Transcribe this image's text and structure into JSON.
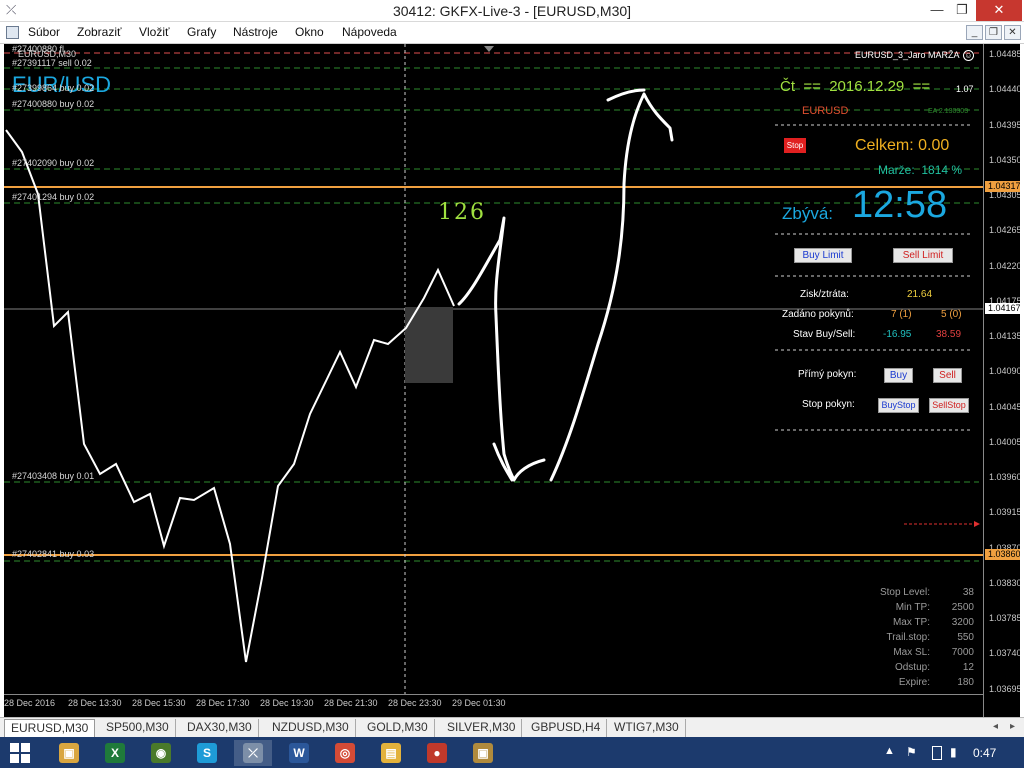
{
  "window": {
    "title": "30412: GKFX-Live-3 - [EURUSD,M30]",
    "minimize": "—",
    "maximize": "❐",
    "close": "✕"
  },
  "menu": [
    "Súbor",
    "Zobraziť",
    "Vložiť",
    "Grafy",
    "Nástroje",
    "Okno",
    "Nápoveda"
  ],
  "chart": {
    "symbol_tiny": "EURUSD,M30",
    "symbol_big": "EUR/USD",
    "annotation": "126",
    "price_ticks": [
      "1.04485",
      "1.04440",
      "1.04395",
      "1.04350",
      "1.04305",
      "1.04265",
      "1.04220",
      "1.04175",
      "1.04135",
      "1.04090",
      "1.04045",
      "1.04005",
      "1.03960",
      "1.03915",
      "1.03870",
      "1.03830",
      "1.03785",
      "1.03740",
      "1.03695"
    ],
    "price_marker_1": "1.04317",
    "price_marker_2": "1.04167",
    "price_marker_3": "1.03860",
    "time_ticks": [
      "28 Dec 2016",
      "28 Dec 13:30",
      "28 Dec 15:30",
      "28 Dec 17:30",
      "28 Dec 19:30",
      "28 Dec 21:30",
      "28 Dec 23:30",
      "29 Dec 01:30"
    ],
    "orders": {
      "o1": "#27400880 fl",
      "o2": "#27391117 sell 0.02",
      "o3": "#27399864 buy 0.02",
      "o4": "#27400880 buy 0.02",
      "o5": "#27402090 buy 0.02",
      "o6": "#27401294 buy 0.02",
      "o7": "#27403408 buy 0.01",
      "o8": "#27402841 buy 0.03"
    }
  },
  "panel": {
    "ea_name": "EURUSD_3_Jaro MARŽA",
    "leverage": "1.07",
    "date_line": "Čt  ==  2016.12.29  ==",
    "symbol": "EURUSD",
    "ea_version": "EA 2.130303",
    "stop_label": "Stop",
    "celkem": "Celkem: 0.00",
    "marze": "Marže:  1814 %",
    "zbyva_label": "Zbývá:",
    "zbyva_time": "12:58",
    "buy_limit": "Buy Limit",
    "sell_limit": "Sell Limit",
    "zisk_label": "Zisk/ztráta:",
    "zisk_value": "21.64",
    "zadano_label": "Zadáno pokynů:",
    "zadano_buy": "7 (1)",
    "zadano_sell": "5 (0)",
    "stav_label": "Stav Buy/Sell:",
    "stav_buy": "-16.95",
    "stav_sell": "38.59",
    "primy_label": "Přímý pokyn:",
    "buy_btn": "Buy",
    "sell_btn": "Sell",
    "stop_pokyn_label": "Stop pokyn:",
    "buystop_btn": "BuyStop",
    "sellstop_btn": "SellStop",
    "stats": [
      {
        "label": "Stop Level:",
        "value": "38"
      },
      {
        "label": "Min TP:",
        "value": "2500"
      },
      {
        "label": "Max TP:",
        "value": "3200"
      },
      {
        "label": "Trail.stop:",
        "value": "550"
      },
      {
        "label": "Max SL:",
        "value": "7000"
      },
      {
        "label": "Odstup:",
        "value": "12"
      },
      {
        "label": "Expire:",
        "value": "180"
      }
    ]
  },
  "tabs": [
    "EURUSD,M30",
    "SP500,M30",
    "DAX30,M30",
    "NZDUSD,M30",
    "GOLD,M30",
    "SILVER,M30",
    "GBPUSD,H4",
    "WTIG7,M30"
  ],
  "taskbar": {
    "clock": "0:47",
    "apps": [
      {
        "name": "explorer-app-icon",
        "glyph": "▣",
        "color": "#d9a640"
      },
      {
        "name": "excel-app-icon",
        "glyph": "X",
        "color": "#1f7a3a"
      },
      {
        "name": "globe-app-icon",
        "glyph": "◉",
        "color": "#4a7a2a"
      },
      {
        "name": "skype-app-icon",
        "glyph": "S",
        "color": "#1e9bd7"
      },
      {
        "name": "metatrader-app-icon",
        "glyph": "⤫",
        "color": "#7d8fa8"
      },
      {
        "name": "word-app-icon",
        "glyph": "W",
        "color": "#2b579a"
      },
      {
        "name": "chrome-app-icon",
        "glyph": "◎",
        "color": "#d44b36"
      },
      {
        "name": "folder-app-icon",
        "glyph": "▤",
        "color": "#e3b23c"
      },
      {
        "name": "paint-app-icon",
        "glyph": "●",
        "color": "#c0392b"
      },
      {
        "name": "terminal-app-icon",
        "glyph": "▣",
        "color": "#b08a3c"
      }
    ]
  }
}
